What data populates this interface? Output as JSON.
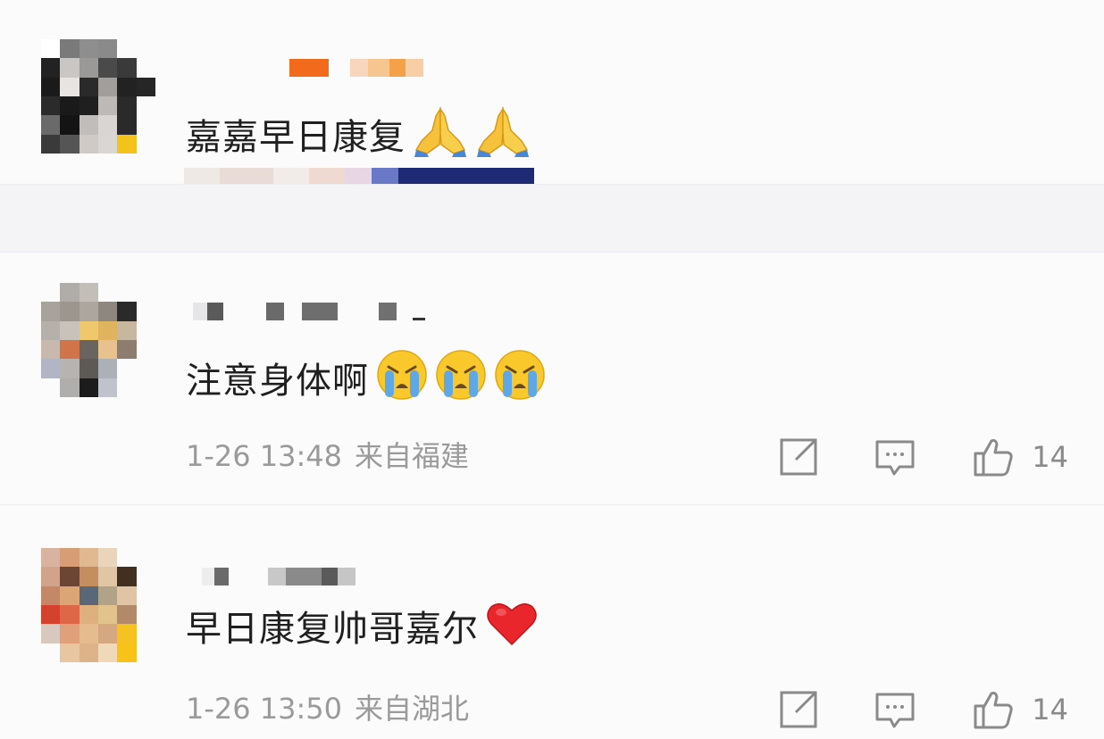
{
  "comments": [
    {
      "text": "嘉嘉早日康复",
      "emoji_icon": "pray-hands-icon",
      "emoji_count": 2
    },
    {
      "text": "注意身体啊",
      "emoji_icon": "crying-face-icon",
      "emoji_count": 3,
      "time": "1-26 13:48",
      "location": "来自福建",
      "likes": "14"
    },
    {
      "text": "早日康复帅哥嘉尔",
      "emoji_icon": "red-heart-icon",
      "emoji_count": 1,
      "time": "1-26 13:50",
      "location": "来自湖北",
      "likes": "14"
    }
  ],
  "colors": {
    "page_bg": "#f4f4f6",
    "card_bg": "#fbfbfc",
    "meta_text": "#9a9a9a",
    "icon_stroke": "#8a8a8a"
  }
}
